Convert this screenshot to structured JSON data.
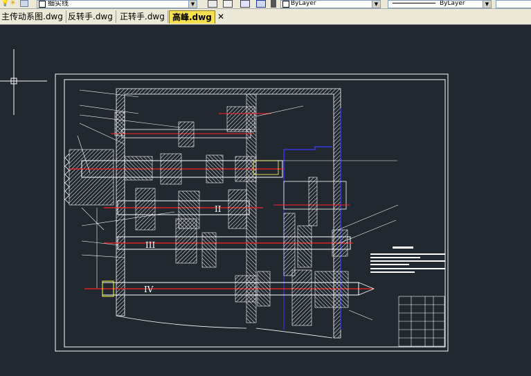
{
  "toolbar": {
    "layer_name": "细实线",
    "color_value": "ByLayer",
    "linetype_value": "ByLayer"
  },
  "tabs": [
    {
      "label": "主传动系图.dwg"
    },
    {
      "label": "反转手.dwg"
    },
    {
      "label": "正转手.dwg"
    },
    {
      "label": "高峰.dwg"
    }
  ],
  "close_glyph": "✕",
  "drawing": {
    "shaft_labels": [
      "II",
      "III",
      "IV"
    ]
  }
}
